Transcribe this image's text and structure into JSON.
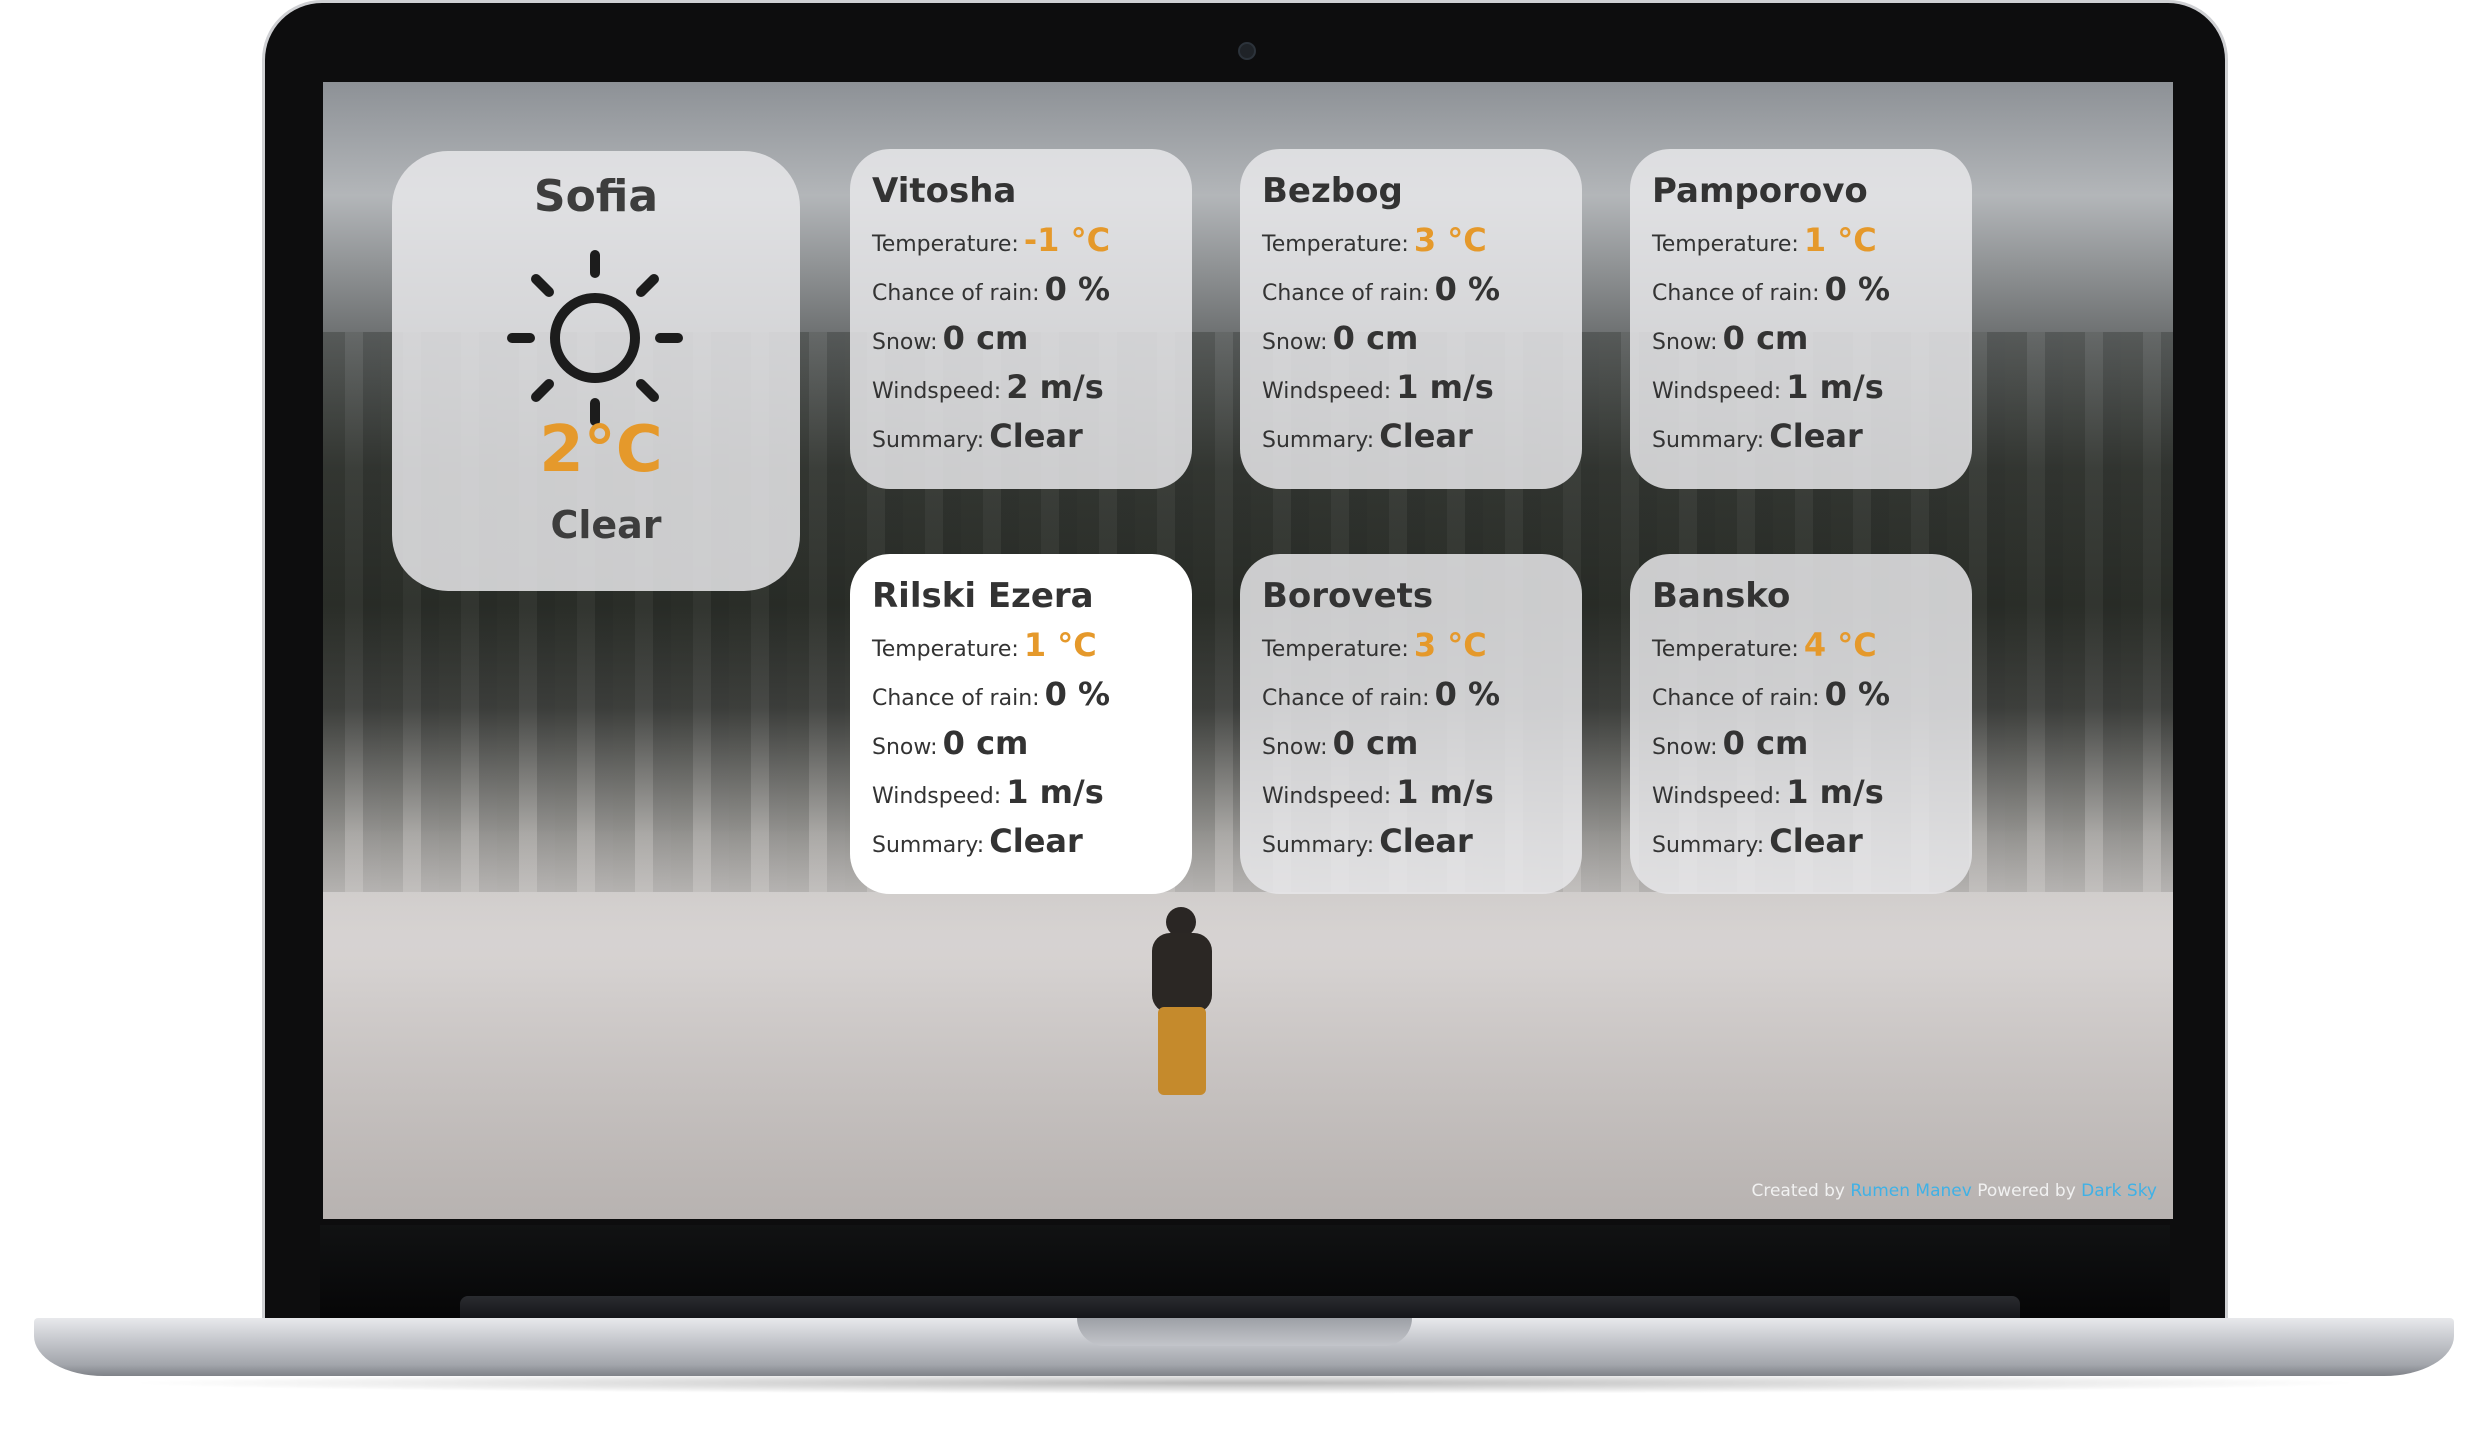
{
  "main": {
    "city": "Sofia",
    "temperature": "2°C",
    "summary": "Clear",
    "icon": "sun-icon"
  },
  "labels": {
    "temperature": "Temperature:",
    "rain": "Chance of rain:",
    "snow": "Snow:",
    "wind": "Windspeed:",
    "summary": "Summary:"
  },
  "resorts": [
    {
      "name": "Vitosha",
      "temperature": "-1 °C",
      "rain": "0 %",
      "snow": "0 cm",
      "wind": "2 m/s",
      "summary": "Clear"
    },
    {
      "name": "Bezbog",
      "temperature": "3 °C",
      "rain": "0 %",
      "snow": "0 cm",
      "wind": "1 m/s",
      "summary": "Clear"
    },
    {
      "name": "Pamporovo",
      "temperature": "1 °C",
      "rain": "0 %",
      "snow": "0 cm",
      "wind": "1 m/s",
      "summary": "Clear"
    },
    {
      "name": "Rilski Ezera",
      "temperature": "1 °C",
      "rain": "0 %",
      "snow": "0 cm",
      "wind": "1 m/s",
      "summary": "Clear"
    },
    {
      "name": "Borovets",
      "temperature": "3 °C",
      "rain": "0 %",
      "snow": "0 cm",
      "wind": "1 m/s",
      "summary": "Clear"
    },
    {
      "name": "Bansko",
      "temperature": "4 °C",
      "rain": "0 %",
      "snow": "0 cm",
      "wind": "1 m/s",
      "summary": "Clear"
    }
  ],
  "footer": {
    "created_by": "Created by",
    "author": "Rumen Manev",
    "powered_by": "Powered by",
    "provider": "Dark Sky"
  },
  "colors": {
    "temperature": "#e5992b",
    "link": "#3fb1e6"
  }
}
